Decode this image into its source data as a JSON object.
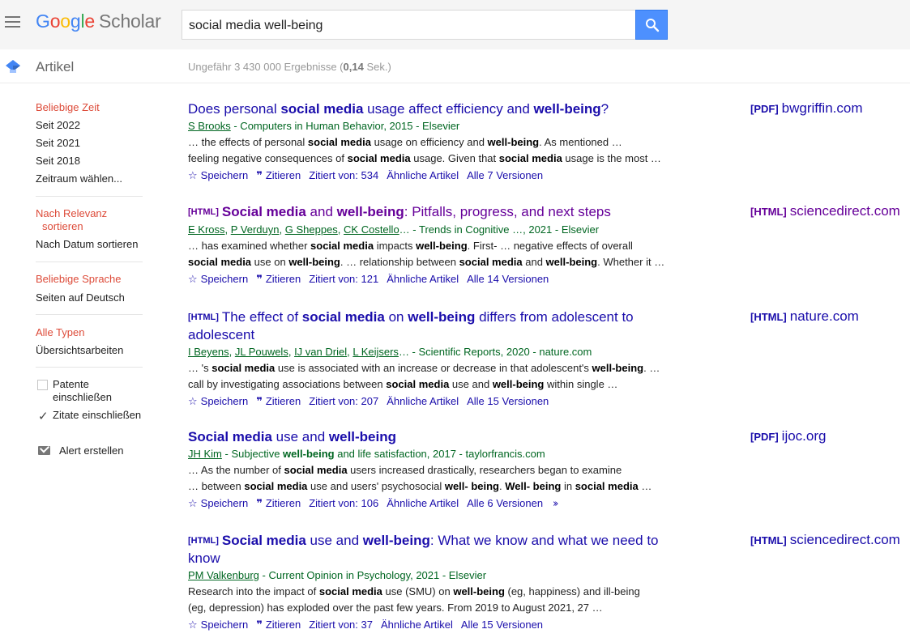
{
  "header": {
    "logo_google": [
      "G",
      "o",
      "o",
      "g",
      "l",
      "e"
    ],
    "logo_scholar": "Scholar",
    "search_value": "social media well-being"
  },
  "subheader": {
    "section": "Artikel",
    "stats_prefix": "Ungefähr 3 430 000 Ergebnisse (",
    "stats_time": "0,14",
    "stats_suffix": " Sek.)"
  },
  "sidebar": {
    "time_header": "Beliebige Zeit",
    "time_options": [
      "Seit 2022",
      "Seit 2021",
      "Seit 2018",
      "Zeitraum wählen..."
    ],
    "sort_relevance_1": "Nach Relevanz",
    "sort_relevance_2": "sortieren",
    "sort_date": "Nach Datum sortieren",
    "lang_header": "Beliebige Sprache",
    "lang_option": "Seiten auf Deutsch",
    "type_header": "Alle Typen",
    "type_option": "Übersichtsarbeiten",
    "patents_1": "Patente",
    "patents_2": "einschließen",
    "citations": "Zitate einschließen",
    "patents_checked": false,
    "citations_checked": true,
    "alert": "Alert erstellen"
  },
  "links": {
    "save": "Speichern",
    "cite": "Zitieren",
    "save_icon": "star-outline-icon",
    "cite_icon": "quote-icon"
  },
  "results": [
    {
      "tag": "",
      "title_html": "Does personal <b>social media</b> usage affect efficiency and <b>well-being</b>?",
      "visited": false,
      "authors": [
        "S Brooks"
      ],
      "meta_rest": " - Computers in Human Behavior, 2015 - Elsevier",
      "snippet1": "… the effects of personal <b>social media</b> usage on efficiency and <b>well-being</b>. As mentioned …",
      "snippet2": "feeling negative consequences of <b>social media</b> usage. Given that <b>social media</b> usage is the most …",
      "cited": "Zitiert von: 534",
      "similar": "Ähnliche Artikel",
      "versions": "Alle 7 Versionen",
      "more": false,
      "side_type": "[PDF]",
      "side_domain": "bwgriffin.com",
      "side_visited": false
    },
    {
      "tag": "[HTML]",
      "title_html": "<b>Social media</b> and <b>well-being</b>: Pitfalls, progress, and next steps",
      "visited": true,
      "authors": [
        "E Kross",
        "P Verduyn",
        "G Sheppes",
        "CK Costello"
      ],
      "meta_rest": "… - Trends in Cognitive …, 2021 - Elsevier",
      "snippet1": "… has examined whether <b>social media</b> impacts <b>well-being</b>. First- … negative effects of overall",
      "snippet2": "<b>social media</b> use on <b>well-being</b>. … relationship between <b>social media</b> and <b>well-being</b>. Whether it …",
      "cited": "Zitiert von: 121",
      "similar": "Ähnliche Artikel",
      "versions": "Alle 14 Versionen",
      "more": false,
      "side_type": "[HTML]",
      "side_domain": "sciencedirect.com",
      "side_visited": true
    },
    {
      "tag": "[HTML]",
      "title_html": "The effect of <b>social media</b> on <b>well-being</b> differs from adolescent to adolescent",
      "visited": false,
      "authors": [
        "I Beyens",
        "JL Pouwels",
        "IJ van Driel",
        "L Keijsers"
      ],
      "meta_rest": "… - Scientific Reports, 2020 - nature.com",
      "snippet1": "… 's <b>social media</b> use is associated with an increase or decrease in that adolescent's <b>well-being</b>. …",
      "snippet2": "call by investigating associations between <b>social media</b> use and <b>well-being</b> within single …",
      "cited": "Zitiert von: 207",
      "similar": "Ähnliche Artikel",
      "versions": "Alle 15 Versionen",
      "more": false,
      "side_type": "[HTML]",
      "side_domain": "nature.com",
      "side_visited": false
    },
    {
      "tag": "",
      "title_html": "<b>Social media</b> use and <b>well-being</b>",
      "visited": false,
      "authors": [
        "JH Kim"
      ],
      "meta_rest_html": " - Subjective <b>well-being</b> and life satisfaction, 2017 - taylorfrancis.com",
      "snippet1": "… As the number of <b>social media</b> users increased drastically, researchers began to examine",
      "snippet2": "… between <b>social media</b> use and users' psychosocial <b>well- being</b>. <b>Well- being</b> in <b>social media</b> …",
      "cited": "Zitiert von: 106",
      "similar": "Ähnliche Artikel",
      "versions": "Alle 6 Versionen",
      "more": true,
      "side_type": "[PDF]",
      "side_domain": "ijoc.org",
      "side_visited": false
    },
    {
      "tag": "[HTML]",
      "title_html": "<b>Social media</b> use and <b>well-being</b>: What we know and what we need to know",
      "visited": false,
      "authors": [
        "PM Valkenburg"
      ],
      "meta_rest": " - Current Opinion in Psychology, 2021 - Elsevier",
      "snippet1": "Research into the impact of <b>social media</b> use (SMU) on <b>well-being</b> (eg, happiness) and ill-being",
      "snippet2": "(eg, depression) has exploded over the past few years. From 2019 to August 2021, 27 …",
      "cited": "Zitiert von: 37",
      "similar": "Ähnliche Artikel",
      "versions": "Alle 15 Versionen",
      "more": false,
      "side_type": "[HTML]",
      "side_domain": "sciencedirect.com",
      "side_visited": false
    }
  ]
}
